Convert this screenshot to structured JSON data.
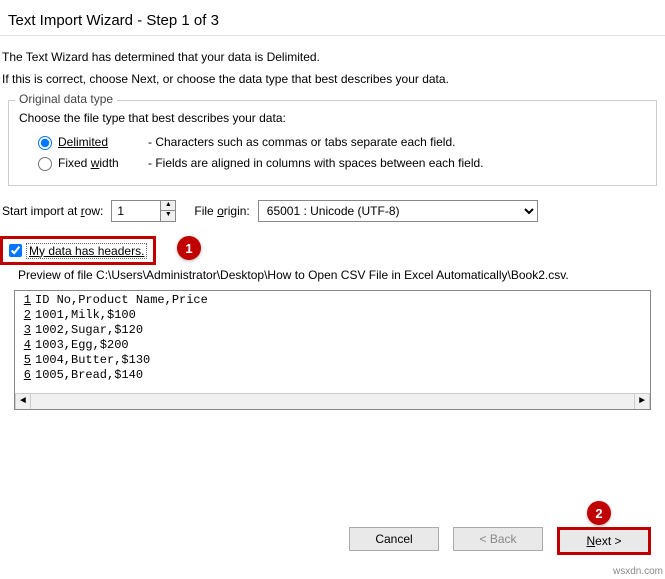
{
  "title": "Text Import Wizard - Step 1 of 3",
  "info1": "The Text Wizard has determined that your data is Delimited.",
  "info2": "If this is correct, choose Next, or choose the data type that best describes your data.",
  "group": {
    "label": "Original data type",
    "desc": "Choose the file type that best describes your data:",
    "delimited": {
      "label": "Delimited",
      "desc": "- Characters such as commas or tabs separate each field."
    },
    "fixed": {
      "label": "Fixed width",
      "desc": "- Fields are aligned in columns with spaces between each field."
    }
  },
  "startRow": {
    "label": "Start import at row:",
    "value": "1"
  },
  "fileOrigin": {
    "label": "File origin:",
    "value": "65001 : Unicode (UTF-8)"
  },
  "headers": {
    "label": "My data has headers."
  },
  "callout1": "1",
  "callout2": "2",
  "previewLabel": "Preview of file C:\\Users\\Administrator\\Desktop\\How to Open CSV File in Excel Automatically\\Book2.csv.",
  "preview": [
    {
      "n": "1",
      "t": "ID No,Product Name,Price"
    },
    {
      "n": "2",
      "t": "1001,Milk,$100"
    },
    {
      "n": "3",
      "t": "1002,Sugar,$120"
    },
    {
      "n": "4",
      "t": "1003,Egg,$200"
    },
    {
      "n": "5",
      "t": "1004,Butter,$130"
    },
    {
      "n": "6",
      "t": "1005,Bread,$140"
    }
  ],
  "buttons": {
    "cancel": "Cancel",
    "back": "< Back",
    "next": "Next >"
  },
  "watermark": "wsxdn.com"
}
